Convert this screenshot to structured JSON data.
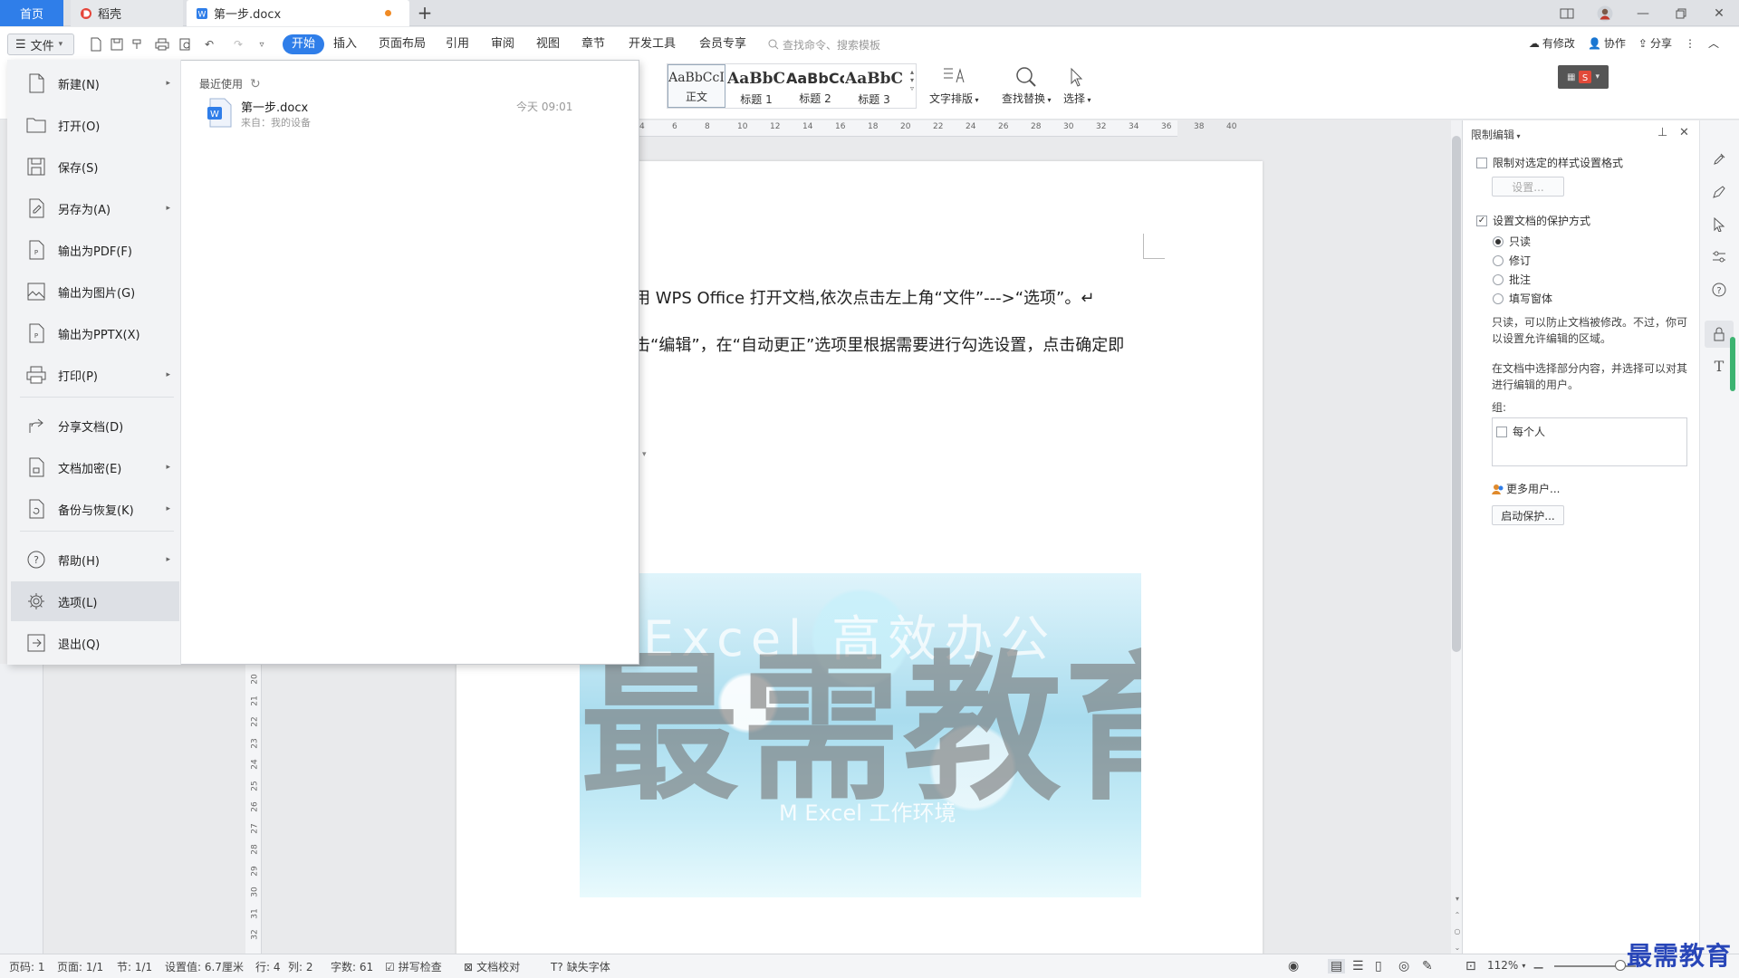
{
  "tabs": {
    "home": "首页",
    "daoke": "稻壳",
    "doc": "第一步.docx",
    "add": "+"
  },
  "menu": {
    "file": "文件",
    "ribbon_tabs": [
      "开始",
      "插入",
      "页面布局",
      "引用",
      "审阅",
      "视图",
      "章节",
      "开发工具",
      "会员专享"
    ],
    "command_search": "查找命令、搜索模板",
    "actions": {
      "modified": "有修改",
      "collab": "协作",
      "share": "分享"
    }
  },
  "ribbon": {
    "styles": [
      {
        "sample": "AaBbCcI",
        "name": "正文"
      },
      {
        "sample": "AaBbC",
        "name": "标题 1"
      },
      {
        "sample": "AaBbCc",
        "name": "标题 2"
      },
      {
        "sample": "AaBbC",
        "name": "标题 3"
      }
    ],
    "text_layout": "文字排版",
    "find_replace": "查找替换",
    "select": "选择"
  },
  "ruler": [
    "4",
    "6",
    "8",
    "10",
    "12",
    "14",
    "16",
    "18",
    "20",
    "22",
    "24",
    "26",
    "28",
    "30",
    "32",
    "34",
    "36",
    "38",
    "40"
  ],
  "vruler": [
    "20",
    "21",
    "22",
    "23",
    "24",
    "25",
    "26",
    "27",
    "28",
    "29",
    "30",
    "31",
    "32"
  ],
  "file_menu": {
    "items": [
      {
        "label": "新建(N)",
        "icon": "new-file-icon",
        "arrow": true
      },
      {
        "label": "打开(O)",
        "icon": "folder-icon",
        "arrow": false
      },
      {
        "label": "保存(S)",
        "icon": "save-icon",
        "arrow": false
      },
      {
        "label": "另存为(A)",
        "icon": "save-as-icon",
        "arrow": true
      },
      {
        "label": "输出为PDF(F)",
        "icon": "pdf-icon",
        "arrow": false
      },
      {
        "label": "输出为图片(G)",
        "icon": "image-icon",
        "arrow": false
      },
      {
        "label": "输出为PPTX(X)",
        "icon": "pptx-icon",
        "arrow": false
      },
      {
        "label": "打印(P)",
        "icon": "printer-icon",
        "arrow": true
      },
      {
        "label": "分享文档(D)",
        "icon": "share-icon",
        "arrow": false
      },
      {
        "label": "文档加密(E)",
        "icon": "lock-file-icon",
        "arrow": true
      },
      {
        "label": "备份与恢复(K)",
        "icon": "backup-icon",
        "arrow": true
      },
      {
        "label": "帮助(H)",
        "icon": "help-icon",
        "arrow": true
      },
      {
        "label": "选项(L)",
        "icon": "gear-icon",
        "arrow": false
      },
      {
        "label": "退出(Q)",
        "icon": "exit-icon",
        "arrow": false
      }
    ],
    "recent_title": "最近使用",
    "recent_files": [
      {
        "name": "第一步.docx",
        "source": "来自：我的设备",
        "time": "今天 09:01"
      }
    ]
  },
  "document": {
    "line1": "用 WPS Office 打开文档,依次点击左上角“文件”--->“选项”。↵",
    "line2": "击“编辑”，在“自动更正”选项里根据需要进行勾选设置，点击确定即",
    "image_top_text": "Excel 高效办公",
    "image_watermark": "最需教育",
    "image_sub_text": "M Excel 工作环境"
  },
  "right_panel": {
    "title": "限制编辑",
    "restrict_format": "限制对选定的样式设置格式",
    "settings_btn": "设置...",
    "protect_mode": "设置文档的保护方式",
    "options": [
      "只读",
      "修订",
      "批注",
      "填写窗体"
    ],
    "selected_option": "只读",
    "note1": "只读，可以防止文档被修改。不过，你可以设置允许编辑的区域。",
    "note2": "在文档中选择部分内容，并选择可以对其进行编辑的用户。",
    "group_label": "组:",
    "everyone": "每个人",
    "more_users": "更多用户...",
    "start_protect": "启动保护..."
  },
  "status": {
    "page_code": "页码: 1",
    "page": "页面: 1/1",
    "section": "节: 1/1",
    "setting": "设置值: 6.7厘米",
    "row": "行: 4",
    "col": "列: 2",
    "words": "字数: 61",
    "spell": "拼写检查",
    "proof": "文档校对",
    "missing_font": "缺失字体",
    "zoom": "112%"
  },
  "brand_watermark": "最需教育",
  "colors": {
    "accent": "#2f7ee9",
    "panel": "#f2f3f5",
    "doc_dot": "#f08a24"
  }
}
